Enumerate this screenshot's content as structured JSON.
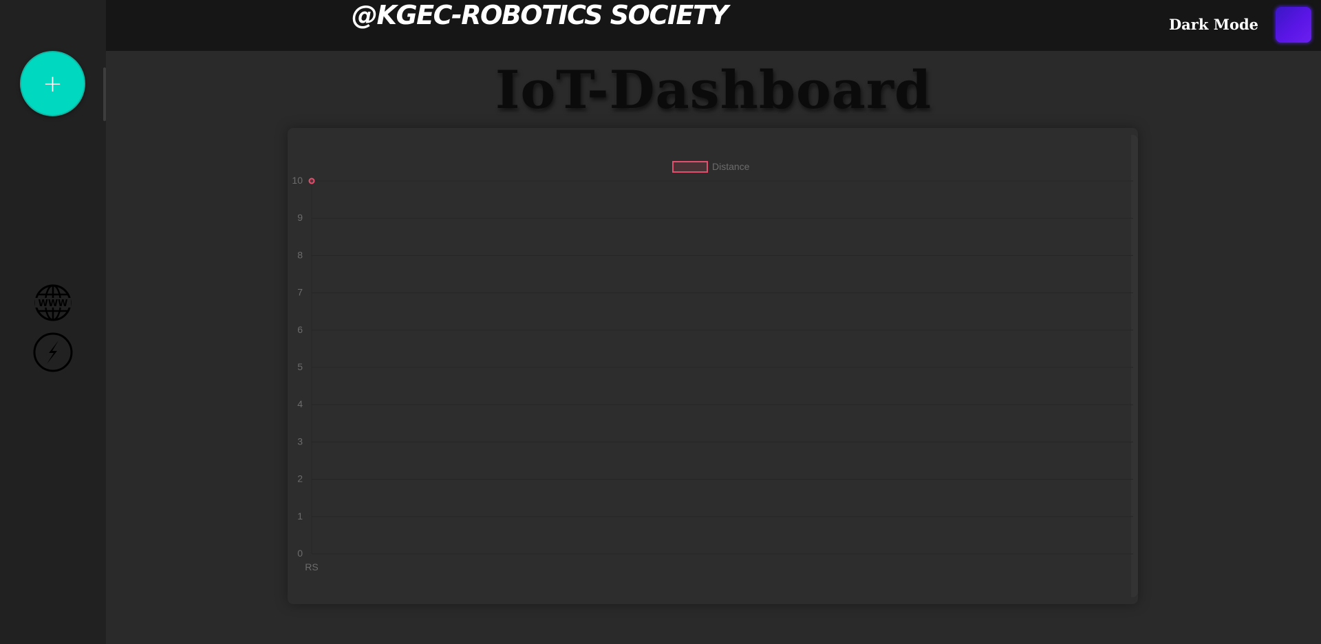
{
  "header": {
    "brand": "@KGEC-ROBOTICS SOCIETY",
    "mode_label": "Dark Mode"
  },
  "main": {
    "title": "IoT-Dashboard"
  },
  "sidebar": {
    "add_label": "+",
    "icons": [
      "www-globe-icon",
      "lightning-circle-icon"
    ]
  },
  "colors": {
    "accent_teal": "#00d9c0",
    "toggle_purple": "#5a16e6",
    "series": "#e3506e"
  },
  "chart_data": {
    "type": "line",
    "categories": [
      "RS"
    ],
    "series": [
      {
        "name": "Distance",
        "values": [
          10
        ],
        "color": "#e3506e"
      }
    ],
    "legend": "top-center",
    "ylim": [
      0,
      10
    ],
    "yticks": [
      0,
      1,
      2,
      3,
      4,
      5,
      6,
      7,
      8,
      9,
      10
    ],
    "grid": true
  }
}
